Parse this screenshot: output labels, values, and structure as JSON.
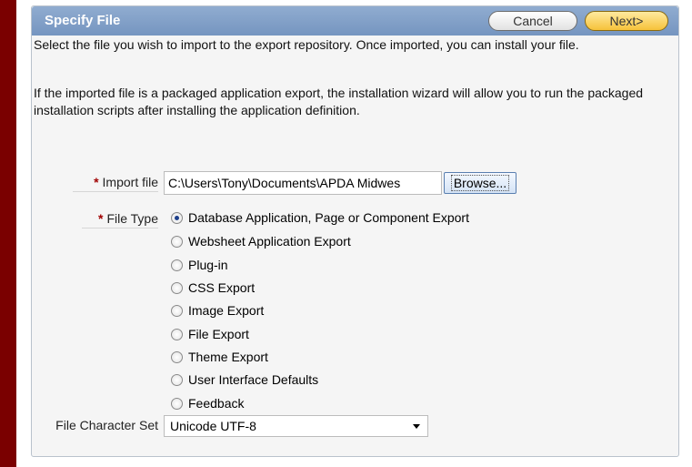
{
  "region": {
    "title": "Specify File",
    "cancel_label": "Cancel",
    "next_label": "Next>"
  },
  "instructions": {
    "p1": "Select the file you wish to import to the export repository. Once imported, you can install your file.",
    "p2": "If the imported file is a packaged application export, the installation wizard will allow you to run the packaged installation scripts after installing the application definition."
  },
  "form": {
    "import_file_label": "Import file",
    "import_file_value": "C:\\Users\\Tony\\Documents\\APDA Midwes",
    "browse_label": "Browse...",
    "file_type_label": "File Type",
    "file_types": [
      "Database Application, Page or Component Export",
      "Websheet Application Export",
      "Plug-in",
      "CSS Export",
      "Image Export",
      "File Export",
      "Theme Export",
      "User Interface Defaults",
      "Feedback"
    ],
    "selected_file_type": "Database Application, Page or Component Export",
    "charset_label": "File Character Set",
    "charset_value": "Unicode UTF-8",
    "required_marker": "*"
  },
  "colors": {
    "frame": "#7a0000",
    "header": "#7f9ec7",
    "next_button": "#f6c23a"
  }
}
